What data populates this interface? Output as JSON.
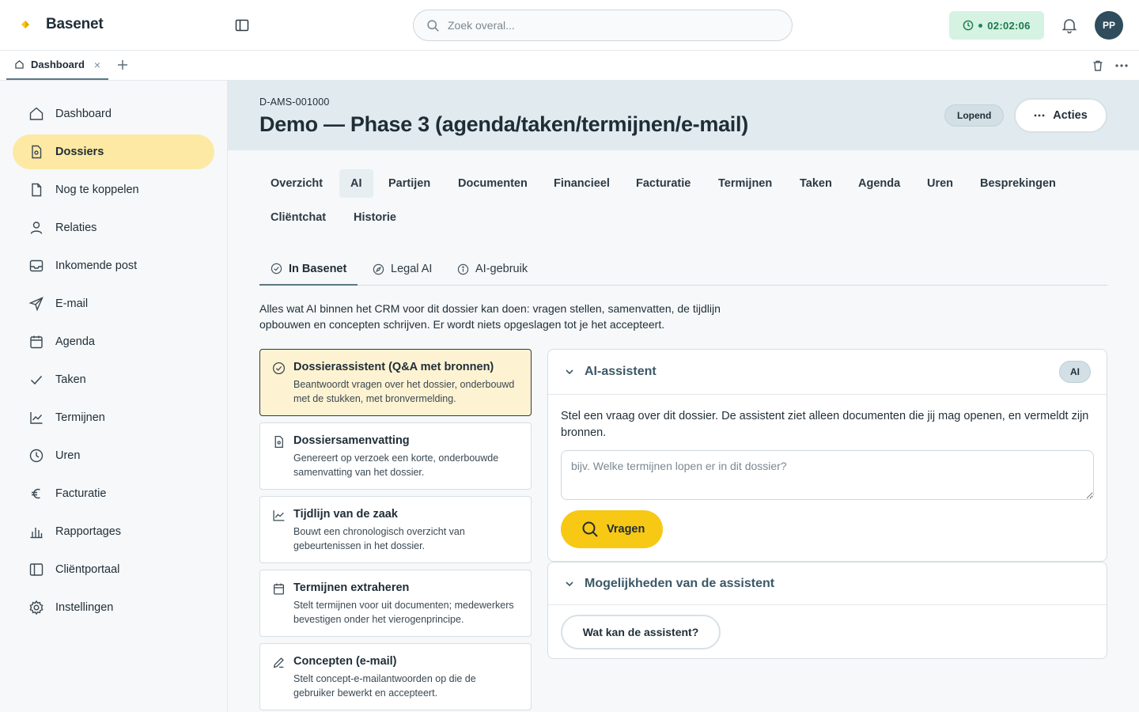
{
  "app": {
    "name": "Basenet",
    "brand_color": "#f7c814"
  },
  "search": {
    "placeholder": "Zoek overal..."
  },
  "timer": {
    "value": "02:02:06"
  },
  "user": {
    "initials": "PP"
  },
  "workspace_tabs": [
    {
      "label": "Dashboard",
      "close": "×"
    }
  ],
  "sidebar": {
    "items": [
      {
        "label": "Dashboard",
        "icon": "home-icon"
      },
      {
        "label": "Dossiers",
        "icon": "file-icon",
        "active": true
      },
      {
        "label": "Nog te koppelen",
        "icon": "document-icon"
      },
      {
        "label": "Relaties",
        "icon": "user-icon"
      },
      {
        "label": "Inkomende post",
        "icon": "inbox-icon"
      },
      {
        "label": "E-mail",
        "icon": "send-icon"
      },
      {
        "label": "Agenda",
        "icon": "calendar-icon"
      },
      {
        "label": "Taken",
        "icon": "check-icon"
      },
      {
        "label": "Termijnen",
        "icon": "line-chart-icon"
      },
      {
        "label": "Uren",
        "icon": "clock-icon"
      },
      {
        "label": "Facturatie",
        "icon": "euro-icon"
      },
      {
        "label": "Rapportages",
        "icon": "bar-chart-icon"
      },
      {
        "label": "Cliëntportaal",
        "icon": "panel-icon"
      },
      {
        "label": "Instellingen",
        "icon": "gear-icon"
      }
    ]
  },
  "case": {
    "id": "D-AMS-001000",
    "title": "Demo — Phase 3 (agenda/taken/termijnen/e-mail)",
    "status": "Lopend",
    "actions_label": "Acties"
  },
  "main_tabs": [
    {
      "label": "Overzicht"
    },
    {
      "label": "AI",
      "active": true
    },
    {
      "label": "Partijen"
    },
    {
      "label": "Documenten"
    },
    {
      "label": "Financieel"
    },
    {
      "label": "Facturatie"
    },
    {
      "label": "Termijnen"
    },
    {
      "label": "Taken"
    },
    {
      "label": "Agenda"
    },
    {
      "label": "Uren"
    },
    {
      "label": "Besprekingen"
    },
    {
      "label": "Cliëntchat"
    },
    {
      "label": "Historie"
    }
  ],
  "sub_tabs": [
    {
      "label": "In Basenet",
      "icon": "check-circle-icon",
      "active": true
    },
    {
      "label": "Legal AI",
      "icon": "compass-icon"
    },
    {
      "label": "AI-gebruik",
      "icon": "info-icon"
    }
  ],
  "intro": {
    "line1": "Alles wat AI binnen het CRM voor dit dossier kan doen: vragen stellen, samenvatten, de tijdlijn",
    "line2": "opbouwen en concepten schrijven. Er wordt niets opgeslagen tot je het accepteert."
  },
  "cards": [
    {
      "title": "Dossierassistent (Q&A met bronnen)",
      "desc1": "Beantwoordt vragen over het dossier, onderbouwd",
      "desc2": "met de stukken, met bronvermelding.",
      "icon": "check-circle-icon",
      "active": true
    },
    {
      "title": "Dossiersamenvatting",
      "desc1": "Genereert op verzoek een korte, onderbouwde",
      "desc2": "samenvatting van het dossier.",
      "icon": "file-icon"
    },
    {
      "title": "Tijdlijn van de zaak",
      "desc1": "Bouwt een chronologisch overzicht van",
      "desc2": "gebeurtenissen in het dossier.",
      "icon": "line-chart-icon"
    },
    {
      "title": "Termijnen extraheren",
      "desc1": "Stelt termijnen voor uit documenten; medewerkers",
      "desc2": "bevestigen onder het vierogenprincipe.",
      "icon": "calendar-icon"
    },
    {
      "title": "Concepten (e-mail)",
      "desc1": "Stelt concept-e-mailantwoorden op die de",
      "desc2": "gebruiker bewerkt en accepteert.",
      "icon": "pencil-icon"
    }
  ],
  "assistant": {
    "title": "AI-assistent",
    "badge": "AI",
    "text": "Stel een vraag over dit dossier. De assistent ziet alleen documenten die jij mag openen, en vermeldt zijn bronnen.",
    "placeholder": "bijv. Welke termijnen lopen er in dit dossier?",
    "ask_label": "Vragen"
  },
  "capabilities": {
    "title": "Mogelijkheden van de assistent",
    "button_label": "Wat kan de assistent?"
  }
}
